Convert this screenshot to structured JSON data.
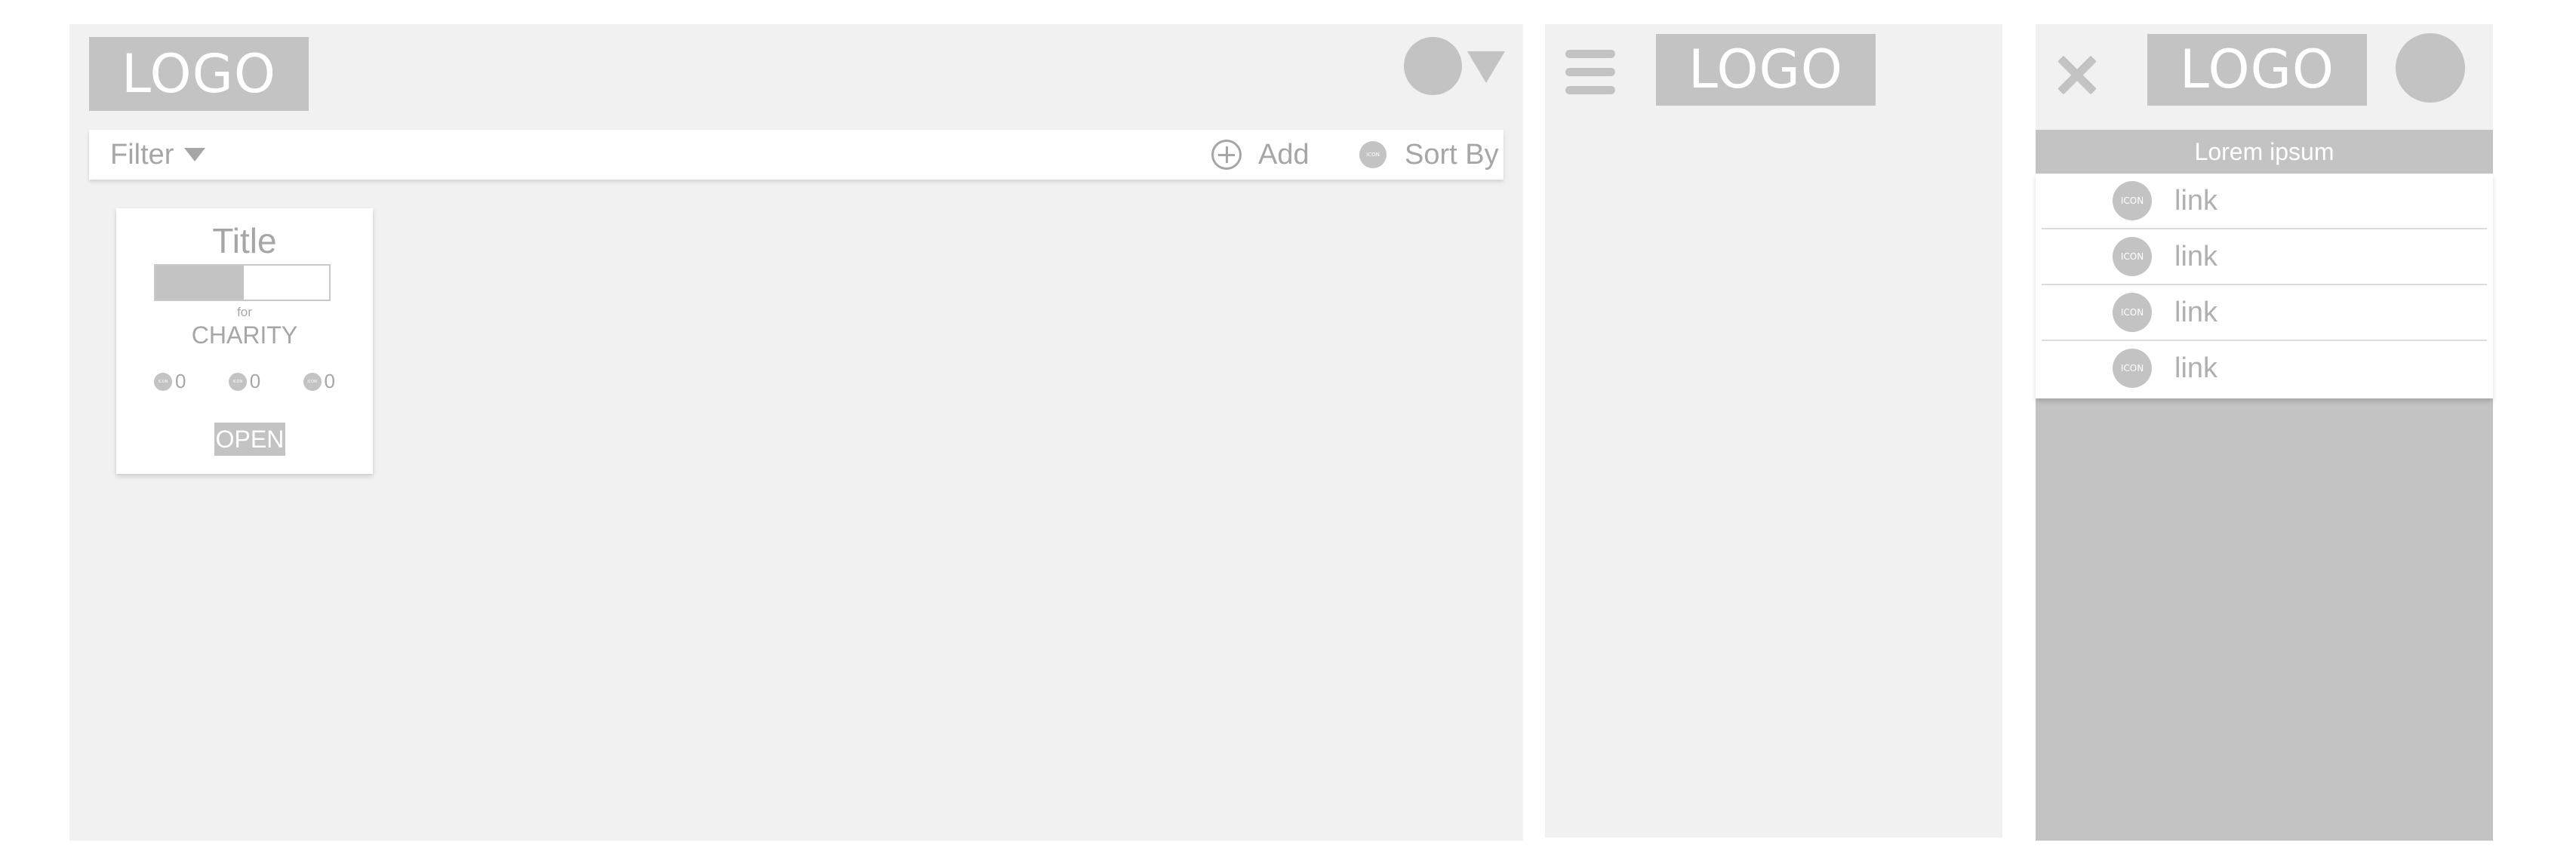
{
  "desktop": {
    "logo": "LOGO",
    "toolbar": {
      "filter_label": "Filter",
      "add_label": "Add",
      "sort_icon": "ICON",
      "sort_label": "Sort By"
    },
    "card": {
      "title": "Title",
      "progress": 0.51,
      "for_label": "for",
      "charity": "CHARITY",
      "stats": [
        {
          "icon": "ICON",
          "value": "0"
        },
        {
          "icon": "ICON",
          "value": "0"
        },
        {
          "icon": "ICON",
          "value": "0"
        }
      ],
      "open_label": "OPEN"
    }
  },
  "mobile": {
    "logo": "LOGO"
  },
  "menu": {
    "logo": "LOGO",
    "header": "Lorem ipsum",
    "items": [
      {
        "icon": "ICON",
        "label": "link"
      },
      {
        "icon": "ICON",
        "label": "link"
      },
      {
        "icon": "ICON",
        "label": "link"
      },
      {
        "icon": "ICON",
        "label": "link"
      }
    ]
  }
}
